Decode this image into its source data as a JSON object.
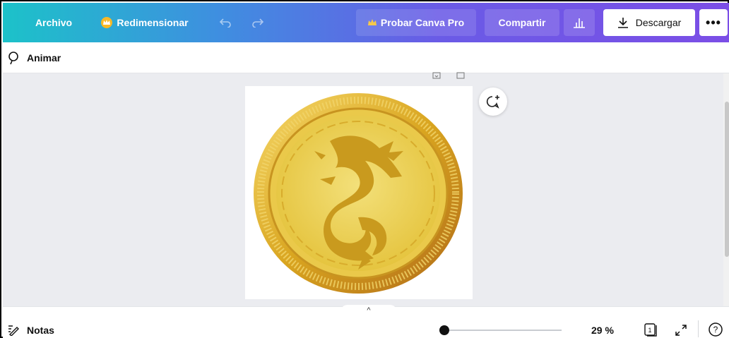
{
  "topbar": {
    "archivo_label": "Archivo",
    "resize_label": "Redimensionar",
    "pro_label": "Probar Canva Pro",
    "share_label": "Compartir",
    "download_label": "Descargar",
    "more_label": "•••"
  },
  "toolbar": {
    "animate_label": "Animar"
  },
  "footer": {
    "notes_label": "Notas",
    "zoom_value": "29 %",
    "page_count": "1",
    "zoom_level": 0.29
  },
  "colors": {
    "gradient_start": "#1cc2c9",
    "gradient_end": "#7b4ee6",
    "canvas_bg": "#ebecf0",
    "coin_gold": "#e8c53a",
    "dragon_gold": "#c99a1e"
  },
  "icons": [
    "crown-icon",
    "undo-icon",
    "redo-icon",
    "stats-icon",
    "download-icon",
    "more-icon",
    "animate-icon",
    "comment-add-icon",
    "notes-icon",
    "pages-icon",
    "expand-icon",
    "help-icon"
  ]
}
